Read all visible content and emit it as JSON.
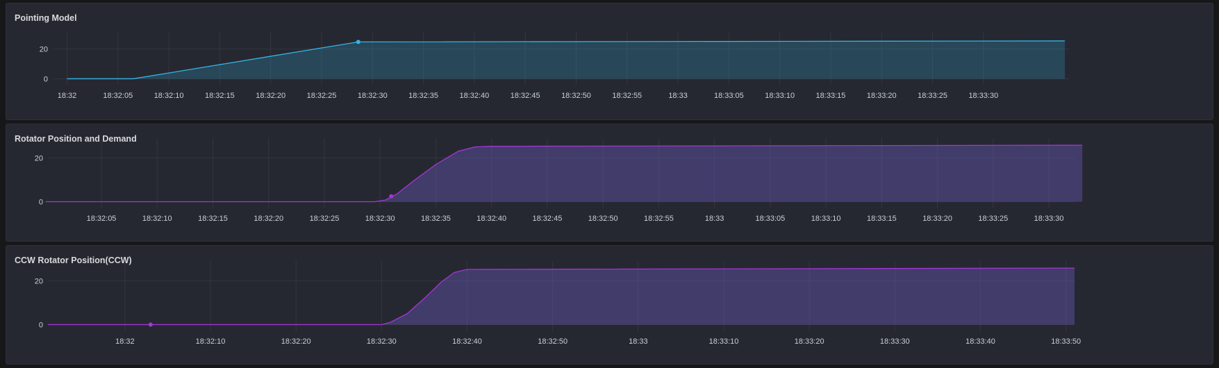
{
  "panels": [
    {
      "title": "Pointing Model",
      "color": "#33b5e5",
      "fill": "rgba(51,181,229,0.22)",
      "chart_data": {
        "type": "area",
        "x": [
          "18:32:00",
          "18:32:06.5",
          "18:32:28.6",
          "18:33:38"
        ],
        "series": [
          {
            "values": [
              0,
              0,
              24.8,
              25.5
            ]
          }
        ],
        "marker": {
          "x": "18:32:28.6",
          "y": 24.8
        },
        "xlim": [
          "18:31:58.6",
          "18:33:38.4"
        ],
        "ylim": [
          -4,
          32
        ],
        "yticks": [
          0,
          20
        ],
        "xtick_times": [
          "18:32:00",
          "18:32:05",
          "18:32:10",
          "18:32:15",
          "18:32:20",
          "18:32:25",
          "18:32:30",
          "18:32:35",
          "18:32:40",
          "18:32:45",
          "18:32:50",
          "18:32:55",
          "18:33:00",
          "18:33:05",
          "18:33:10",
          "18:33:15",
          "18:33:20",
          "18:33:25",
          "18:33:30"
        ],
        "xtick_labels": [
          "18:32",
          "18:32:05",
          "18:32:10",
          "18:32:15",
          "18:32:20",
          "18:32:25",
          "18:32:30",
          "18:32:35",
          "18:32:40",
          "18:32:45",
          "18:32:50",
          "18:32:55",
          "18:33",
          "18:33:05",
          "18:33:10",
          "18:33:15",
          "18:33:20",
          "18:33:25",
          "18:33:30"
        ],
        "grid": true
      }
    },
    {
      "title": "Rotator Position and Demand",
      "color": "#a436d6",
      "fill": "rgba(110,95,200,0.38)",
      "chart_data": {
        "type": "area",
        "x": [
          "18:32:00",
          "18:32:29.5",
          "18:32:30.5",
          "18:32:31.5",
          "18:32:33",
          "18:32:35",
          "18:32:37",
          "18:32:38.5",
          "18:32:40",
          "18:33:33"
        ],
        "series": [
          {
            "values": [
              0,
              0,
              0.8,
              3.5,
              9.5,
              17,
              23,
              25,
              25.3,
              25.8
            ]
          }
        ],
        "marker": {
          "x": "18:32:31",
          "y": 2.5
        },
        "xlim": [
          "18:32:00.2",
          "18:33:32.3"
        ],
        "ylim": [
          -3,
          29
        ],
        "yticks": [
          0,
          20
        ],
        "xtick_times": [
          "18:32:05",
          "18:32:10",
          "18:32:15",
          "18:32:20",
          "18:32:25",
          "18:32:30",
          "18:32:35",
          "18:32:40",
          "18:32:45",
          "18:32:50",
          "18:32:55",
          "18:33:00",
          "18:33:05",
          "18:33:10",
          "18:33:15",
          "18:33:20",
          "18:33:25",
          "18:33:30"
        ],
        "xtick_labels": [
          "18:32:05",
          "18:32:10",
          "18:32:15",
          "18:32:20",
          "18:32:25",
          "18:32:30",
          "18:32:35",
          "18:32:40",
          "18:32:45",
          "18:32:50",
          "18:32:55",
          "18:33",
          "18:33:05",
          "18:33:10",
          "18:33:15",
          "18:33:20",
          "18:33:25",
          "18:33:30"
        ],
        "grid": true
      }
    },
    {
      "title": "CCW Rotator Position(CCW)",
      "color": "#a436d6",
      "fill": "rgba(110,95,200,0.38)",
      "chart_data": {
        "type": "area",
        "x": [
          "18:31:51",
          "18:32:30",
          "18:32:31",
          "18:32:33",
          "18:32:35",
          "18:32:37",
          "18:32:38.5",
          "18:32:40",
          "18:33:51"
        ],
        "series": [
          {
            "values": [
              0,
              0,
              1,
              5,
              12,
              19.5,
              23.8,
              25.2,
              25.8
            ]
          }
        ],
        "marker": {
          "x": "18:32:03",
          "y": 0
        },
        "xlim": [
          "18:31:51",
          "18:33:51"
        ],
        "ylim": [
          -3,
          29
        ],
        "yticks": [
          0,
          20
        ],
        "xtick_times": [
          "18:32:00",
          "18:32:10",
          "18:32:20",
          "18:32:30",
          "18:32:40",
          "18:32:50",
          "18:33:00",
          "18:33:10",
          "18:33:20",
          "18:33:30",
          "18:33:40",
          "18:33:50"
        ],
        "xtick_labels": [
          "18:32",
          "18:32:10",
          "18:32:20",
          "18:32:30",
          "18:32:40",
          "18:32:50",
          "18:33",
          "18:33:10",
          "18:33:20",
          "18:33:30",
          "18:33:40",
          "18:33:50"
        ],
        "grid": true
      }
    }
  ]
}
